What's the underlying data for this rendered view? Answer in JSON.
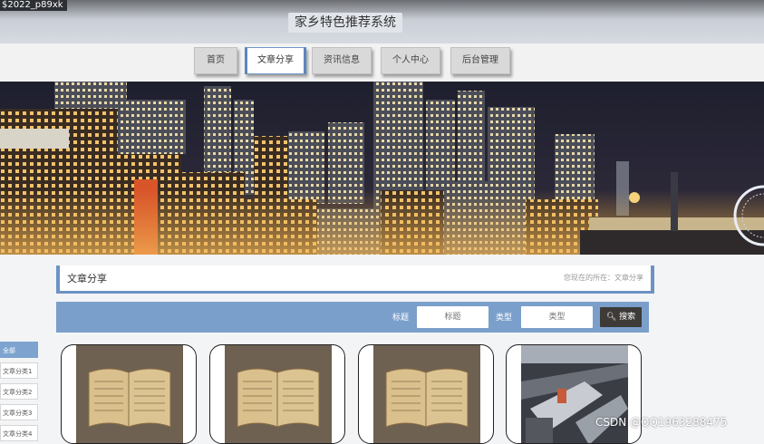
{
  "corner_text": "$2022_p89xk",
  "site_title": "家乡特色推荐系统",
  "nav": [
    {
      "label": "首页"
    },
    {
      "label": "文章分享"
    },
    {
      "label": "资讯信息"
    },
    {
      "label": "个人中心"
    },
    {
      "label": "后台管理"
    }
  ],
  "section": {
    "title": "文章分享",
    "subtitle": "您现在的所在：文章分享"
  },
  "search": {
    "title_label": "标题",
    "title_placeholder": "标题",
    "class_label": "类型",
    "class_placeholder": "类型",
    "button_label": "搜索"
  },
  "categories": [
    "全部",
    "文章分类1",
    "文章分类2",
    "文章分类3",
    "文章分类4"
  ],
  "cards": [
    {
      "image": "open-book-photo"
    },
    {
      "image": "open-book-photo"
    },
    {
      "image": "open-book-photo"
    },
    {
      "image": "library-shelves-photo"
    }
  ],
  "watermark": "CSDN @QQ1963288475",
  "colors": {
    "accent": "#7b9fcb",
    "active_border": "#5b86bd",
    "search_button": "#3d3a37"
  }
}
